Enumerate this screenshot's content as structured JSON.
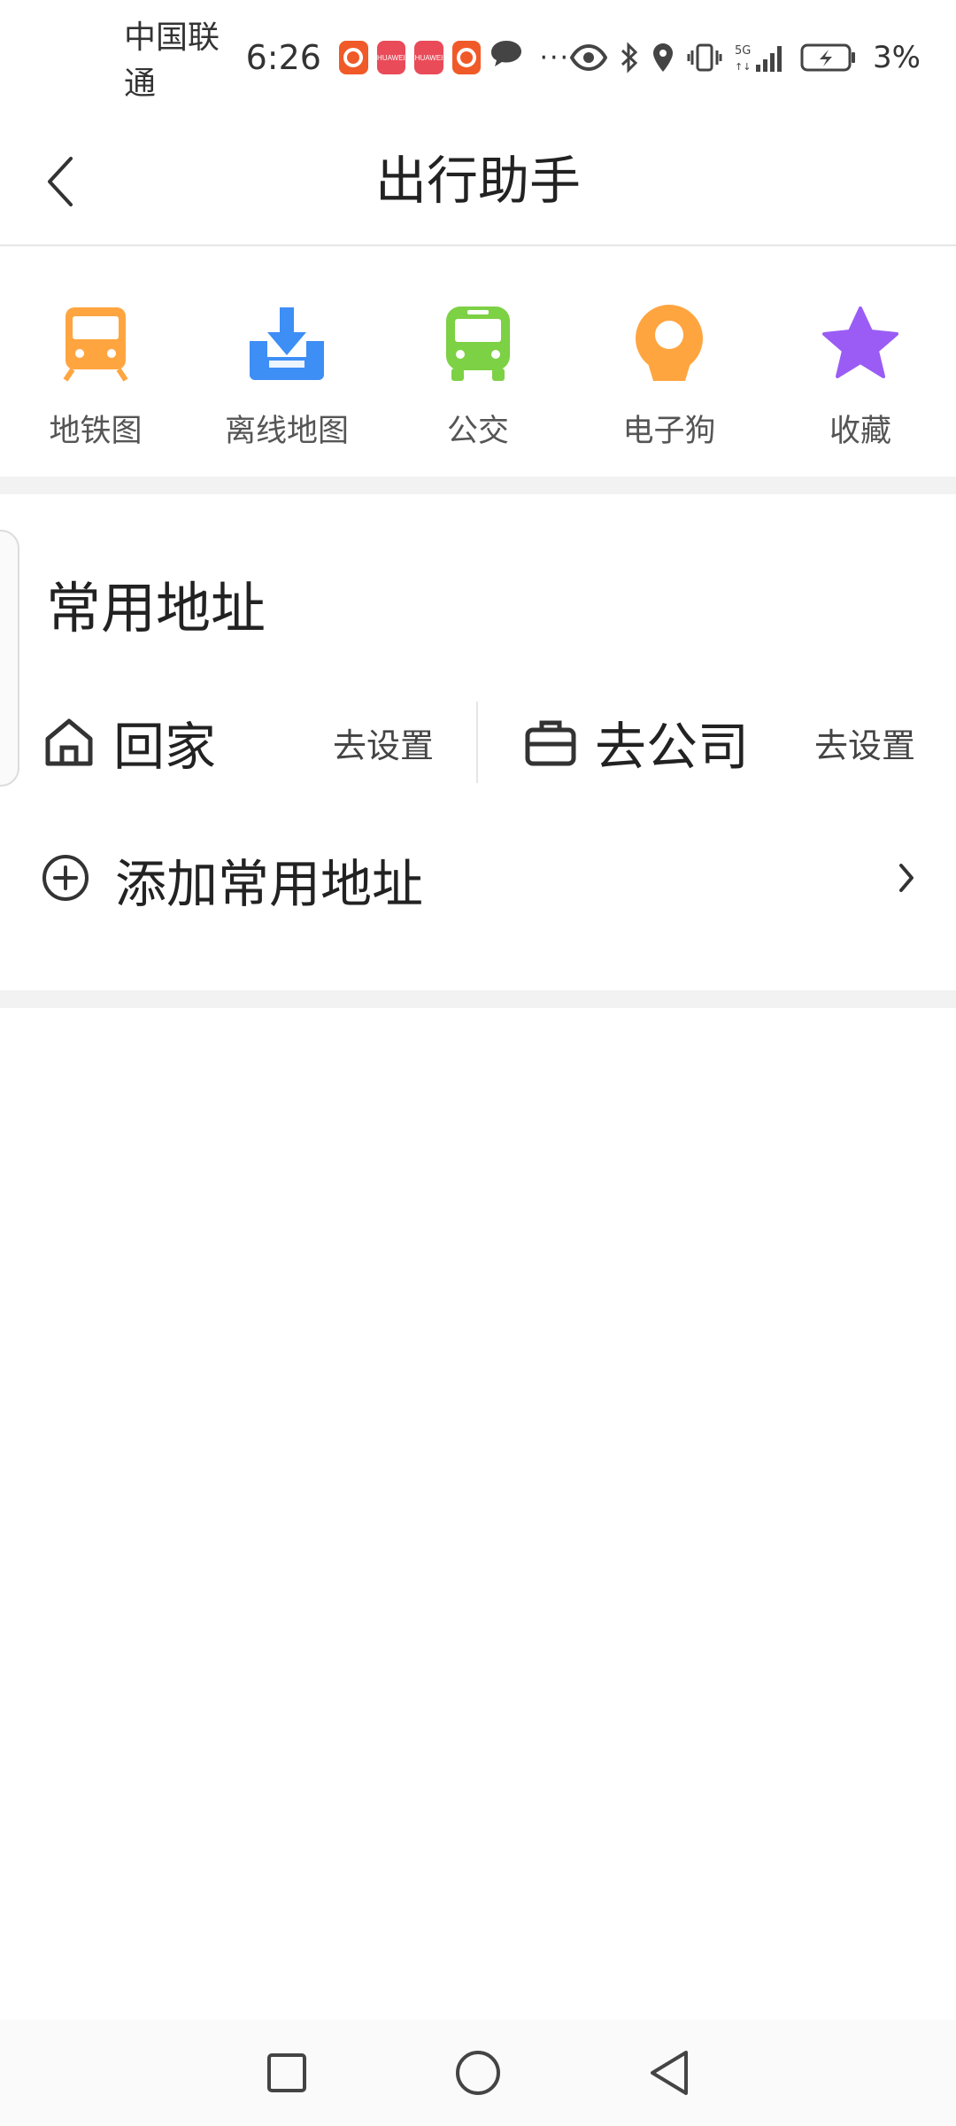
{
  "status_bar": {
    "carrier": "中国联通",
    "time": "6:26",
    "more": "···",
    "network": "5G",
    "battery_pct": "3%",
    "app_badges": [
      {
        "name": "app-icon-orange",
        "color": "#f05a28"
      },
      {
        "name": "huawei-appgallery-icon",
        "color": "#e94b59",
        "text": "HUAWEI"
      },
      {
        "name": "huawei-appgallery-icon",
        "color": "#e94b59",
        "text": "HUAWEI"
      },
      {
        "name": "app-icon-orange",
        "color": "#f05a28"
      }
    ]
  },
  "header": {
    "title": "出行助手"
  },
  "quick_actions": [
    {
      "label": "地铁图",
      "icon": "subway-icon",
      "color": "#ffa540"
    },
    {
      "label": "离线地图",
      "icon": "offline-download-icon",
      "color": "#3d8ef5"
    },
    {
      "label": "公交",
      "icon": "bus-icon",
      "color": "#7dd144"
    },
    {
      "label": "电子狗",
      "icon": "camera-dog-icon",
      "color": "#ffa540"
    },
    {
      "label": "收藏",
      "icon": "star-icon",
      "color": "#9a5cf5"
    }
  ],
  "addresses": {
    "title": "常用地址",
    "home": {
      "label": "回家",
      "action": "去设置"
    },
    "work": {
      "label": "去公司",
      "action": "去设置"
    },
    "add": {
      "label": "添加常用地址"
    }
  },
  "colors": {
    "divider": "#f2f2f2",
    "text_primary": "#222222",
    "text_secondary": "#555555"
  }
}
